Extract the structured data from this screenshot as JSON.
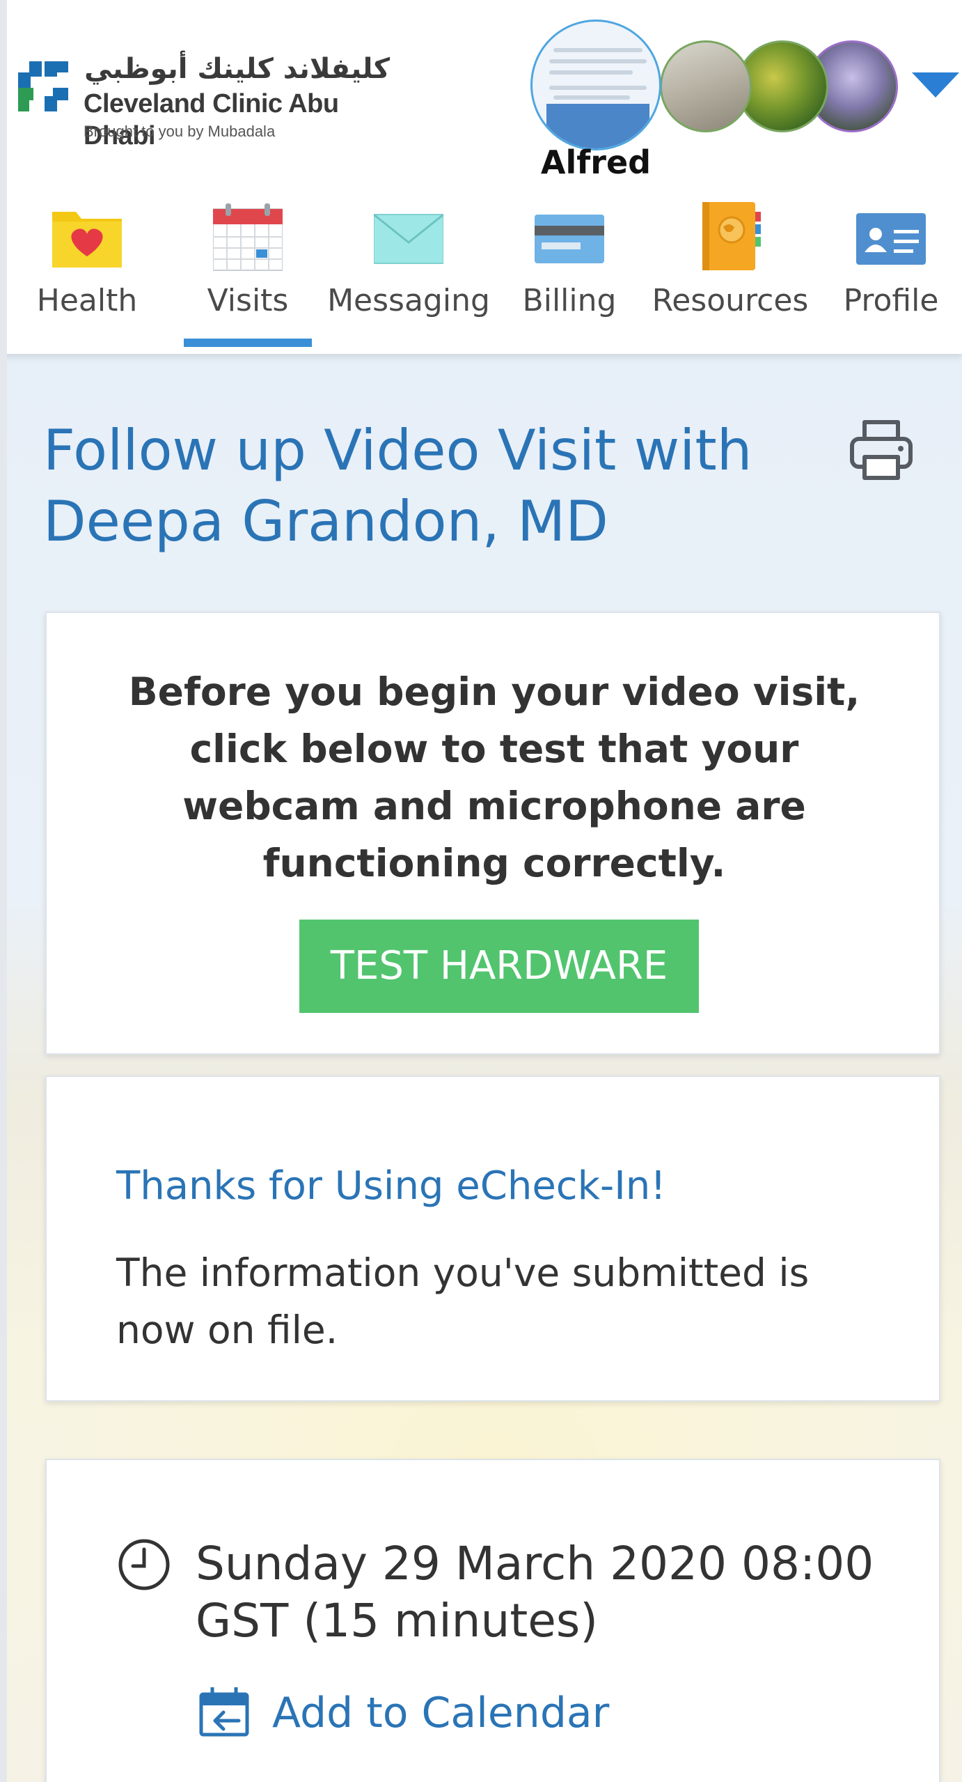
{
  "header": {
    "logo": {
      "arabic": "كليفلاند كلينك أبوظبي",
      "english": "Cleveland Clinic Abu Dhabi",
      "tagline": "Brought to you by Mubadala"
    },
    "account": {
      "name": "Alfred",
      "menu_icon": "caret-down-icon"
    }
  },
  "nav": {
    "active": "Visits",
    "items": [
      {
        "label": "Health",
        "icon": "heart-folder-icon"
      },
      {
        "label": "Visits",
        "icon": "calendar-icon"
      },
      {
        "label": "Messaging",
        "icon": "envelope-icon"
      },
      {
        "label": "Billing",
        "icon": "credit-card-icon"
      },
      {
        "label": "Resources",
        "icon": "book-globe-icon"
      },
      {
        "label": "Profile",
        "icon": "id-card-icon"
      }
    ]
  },
  "main": {
    "title": "Follow up Video Visit with Deepa Grandon, MD",
    "print_icon": "printer-icon",
    "hardware_card": {
      "text": "Before you begin your video visit, click below to test that your webcam and microphone are functioning correctly.",
      "button": "TEST HARDWARE"
    },
    "checkin_card": {
      "title": "Thanks for Using eCheck-In!",
      "text": "The information you've submitted is now on file."
    },
    "time_card": {
      "datetime": "Sunday 29 March 2020 08:00 GST (15 minutes)",
      "add_to_calendar": "Add to Calendar"
    }
  },
  "colors": {
    "accent_blue": "#2a74b6",
    "button_green": "#52c46e",
    "nav_underline": "#3a8fd6"
  }
}
